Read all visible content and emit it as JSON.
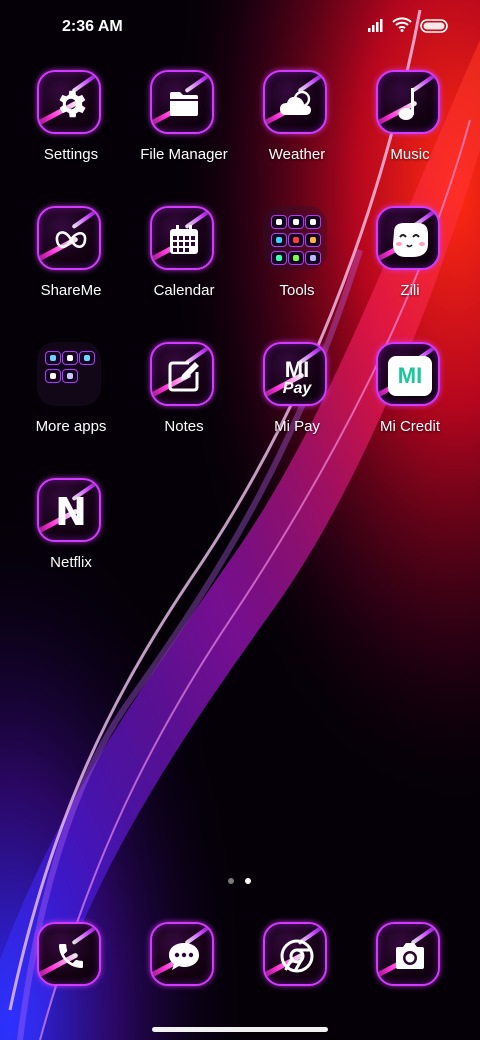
{
  "status_bar": {
    "time": "2:36 AM",
    "icons": [
      "signal-icon",
      "wifi-icon",
      "battery-icon"
    ]
  },
  "apps": [
    {
      "label": "Settings",
      "icon": "gear-icon"
    },
    {
      "label": "File Manager",
      "icon": "folder-icon"
    },
    {
      "label": "Weather",
      "icon": "cloud-icon"
    },
    {
      "label": "Music",
      "icon": "music-note-icon"
    },
    {
      "label": "ShareMe",
      "icon": "infinity-icon"
    },
    {
      "label": "Calendar",
      "icon": "calendar-icon"
    },
    {
      "label": "Tools",
      "icon": "folder-grid-icon"
    },
    {
      "label": "Zili",
      "icon": "face-icon"
    },
    {
      "label": "More apps",
      "icon": "folder-grid-icon"
    },
    {
      "label": "Notes",
      "icon": "pencil-note-icon"
    },
    {
      "label": "Mi Pay",
      "icon": "mi-pay-icon"
    },
    {
      "label": "Mi Credit",
      "icon": "mi-credit-icon"
    },
    {
      "label": "Netflix",
      "icon": "netflix-icon"
    }
  ],
  "icon_text": {
    "mi_pay_top": "MI",
    "mi_pay_bottom": "Pay",
    "mi_credit": "MI",
    "netflix": "N"
  },
  "dock": [
    {
      "icon": "phone-icon"
    },
    {
      "icon": "messages-icon"
    },
    {
      "icon": "chrome-icon"
    },
    {
      "icon": "camera-icon"
    }
  ],
  "page_indicator": {
    "total": 2,
    "active": 2
  },
  "colors": {
    "icon_border": "#d33aff",
    "label": "#ffffff",
    "dot_active": "#ffffff",
    "dot_inactive": "#7a7a7a"
  }
}
